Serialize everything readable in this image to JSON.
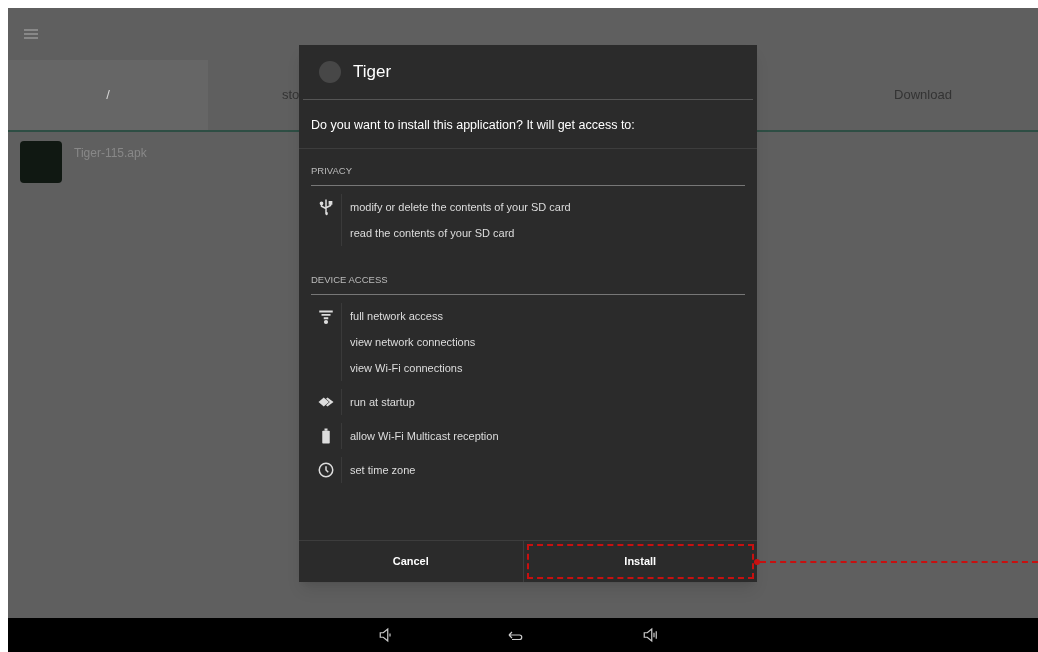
{
  "background": {
    "tabs": [
      {
        "label": "/",
        "selected": true
      },
      {
        "label": "sto",
        "selected": false
      },
      {
        "label": "Download",
        "selected": false
      }
    ],
    "file": {
      "name": "Tiger-115.apk"
    }
  },
  "dialog": {
    "app_name": "Tiger",
    "prompt": "Do you want to install this application? It will get access to:",
    "sections": [
      {
        "header": "PRIVACY",
        "groups": [
          {
            "kind": "usb",
            "permissions": [
              "modify or delete the contents of your SD card",
              "read the contents of your SD card"
            ]
          }
        ]
      },
      {
        "header": "DEVICE ACCESS",
        "groups": [
          {
            "kind": "wifi",
            "permissions": [
              "full network access",
              "view network connections",
              "view Wi-Fi connections"
            ]
          },
          {
            "kind": "layers",
            "permissions": [
              "run at startup"
            ]
          },
          {
            "kind": "battery",
            "permissions": [
              "allow Wi-Fi Multicast reception"
            ]
          },
          {
            "kind": "clock",
            "permissions": [
              "set time zone"
            ]
          }
        ]
      }
    ],
    "buttons": [
      {
        "label": "Cancel",
        "highlighted": false
      },
      {
        "label": "Install",
        "highlighted": true
      }
    ]
  }
}
